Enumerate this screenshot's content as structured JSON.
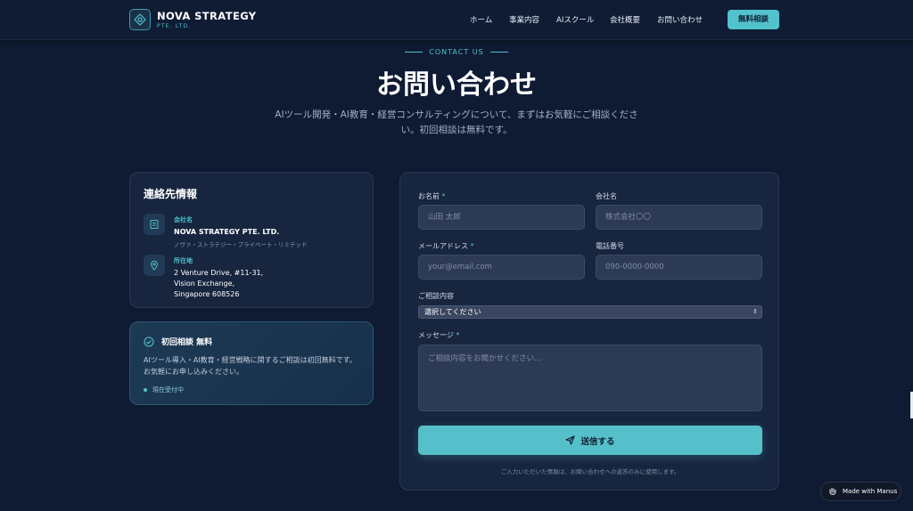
{
  "brand": {
    "name": "NOVA STRATEGY",
    "sub": "PTE. LTD."
  },
  "nav": {
    "items": [
      "ホーム",
      "事業内容",
      "AIスクール",
      "会社概要",
      "お問い合わせ"
    ],
    "cta": "無料相談"
  },
  "hero": {
    "eyebrow": "CONTACT US",
    "title": "お問い合わせ",
    "lead": "AIツール開発・AI教育・経営コンサルティングについて、まずはお気軽にご相談ください。初回相談は無料です。"
  },
  "contact_info": {
    "title": "連絡先情報",
    "company": {
      "label": "会社名",
      "value": "NOVA STRATEGY PTE. LTD.",
      "sub": "ノヴァ・ストラテジー・プライベート・リミテッド"
    },
    "address": {
      "label": "所在地",
      "lines": [
        "2 Venture Drive, #11-31,",
        "Vision Exchange,",
        "Singapore 608526"
      ]
    }
  },
  "consult": {
    "title": "初回相談 無料",
    "desc": "AIツール導入・AI教育・経営戦略に関するご相談は初回無料です。お気軽にお申し込みください。",
    "status": "現在受付中"
  },
  "form": {
    "name": {
      "label": "お名前",
      "required": "*",
      "placeholder": "山田 太郎"
    },
    "company": {
      "label": "会社名",
      "placeholder": "株式会社〇〇"
    },
    "email": {
      "label": "メールアドレス",
      "required": "*",
      "placeholder": "your@email.com"
    },
    "phone": {
      "label": "電話番号",
      "placeholder": "090-0000-0000"
    },
    "inquiry": {
      "label": "ご相談内容",
      "selected": "選択してください"
    },
    "message": {
      "label": "メッセージ",
      "required": "*",
      "placeholder": "ご相談内容をお聞かせください..."
    },
    "submit": "送信する",
    "note": "ご入力いただいた情報は、お問い合わせへの返答のみに使用します。"
  },
  "badge": {
    "label": "Made with Manus"
  },
  "colors": {
    "bg": "#0f1b33",
    "accent": "#52c2cc",
    "card": "#17253f"
  }
}
